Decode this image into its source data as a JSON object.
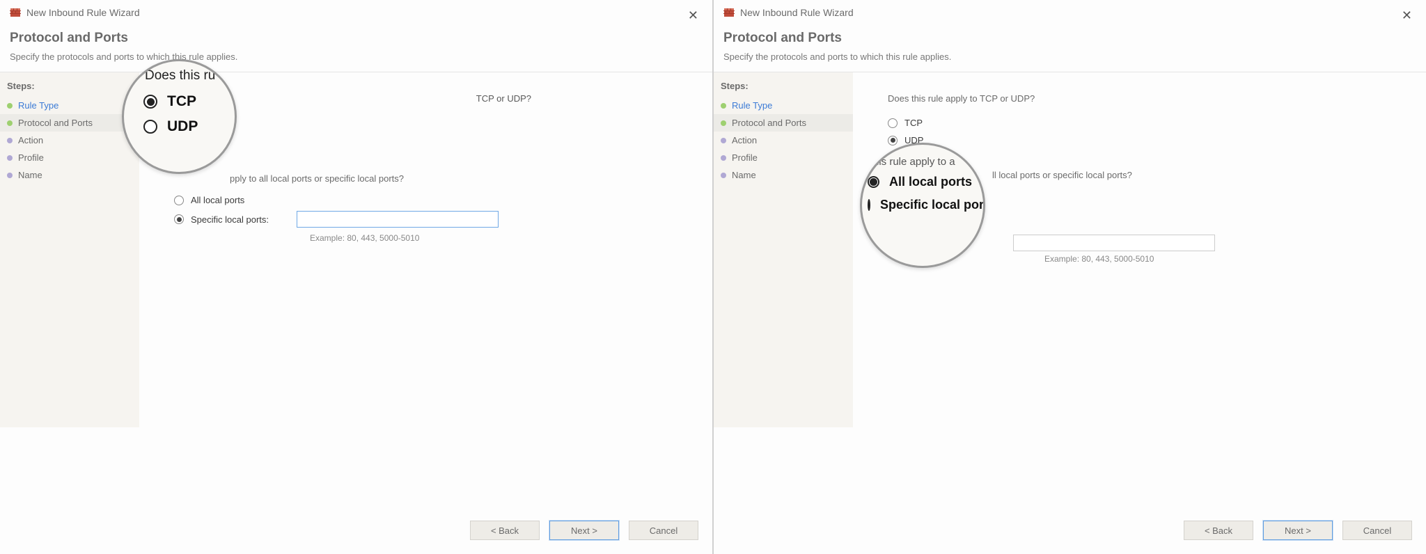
{
  "window": {
    "title": "New Inbound Rule Wizard",
    "close": "✕"
  },
  "page": {
    "heading": "Protocol and Ports",
    "description": "Specify the protocols and ports to which this rule applies."
  },
  "steps": {
    "label": "Steps:",
    "items": [
      {
        "label": "Rule Type",
        "state": "done",
        "link": true
      },
      {
        "label": "Protocol and Ports",
        "state": "done",
        "link": false,
        "selected": true
      },
      {
        "label": "Action",
        "state": "pending",
        "link": false
      },
      {
        "label": "Profile",
        "state": "pending",
        "link": false
      },
      {
        "label": "Name",
        "state": "pending",
        "link": false
      }
    ]
  },
  "content": {
    "q1": "Does this rule apply to TCP or UDP?",
    "tcp": "TCP",
    "udp": "UDP",
    "q2": "Does this rule apply to all local ports or specific local ports?",
    "all_ports": "All local ports",
    "specific_ports": "Specific local ports:",
    "example": "Example: 80, 443, 5000-5010"
  },
  "buttons": {
    "back": "< Back",
    "next": "Next >",
    "cancel": "Cancel"
  },
  "magnifier_left": {
    "title_fragment": "Does this ru",
    "opt1": "TCP",
    "opt2": "UDP",
    "q2_fragment": "pply to all local ports or specific local ports?"
  },
  "magnifier_right": {
    "title_fragment_left": "his rule apply to a",
    "title_fragment_right": "ll local ports or specific local ports?",
    "opt1": "All local ports",
    "opt2": "Specific local ports"
  }
}
